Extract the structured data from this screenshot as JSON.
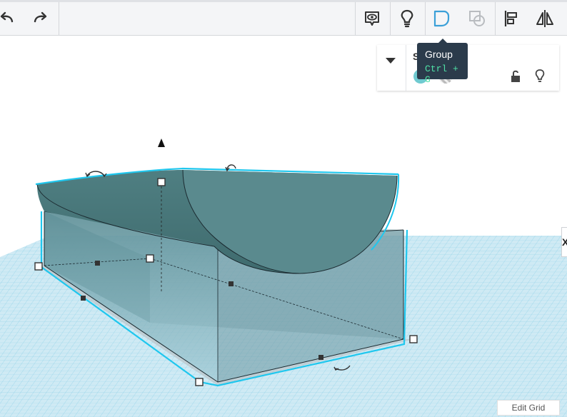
{
  "toolbar": {
    "undo_icon": "undo-icon",
    "redo_icon": "redo-icon",
    "notes_icon": "speech-eye-icon",
    "light_icon": "lightbulb-icon",
    "group_icon": "group-icon",
    "ungroup_icon": "ungroup-icon",
    "align_icon": "align-icon",
    "mirror_icon": "mirror-icon"
  },
  "tooltip": {
    "title": "Group",
    "shortcut": "Ctrl + G"
  },
  "panel": {
    "title": "S",
    "solid_color": "#6fcad0"
  },
  "workplane": {
    "edit_grid_label": "Edit Grid",
    "side_tab_label": "X"
  },
  "colors": {
    "grid_bg": "#cfeaf4",
    "grid_line": "#7ec9e5",
    "shape_top": "#4f7e80",
    "selection": "#1fc7ee"
  }
}
